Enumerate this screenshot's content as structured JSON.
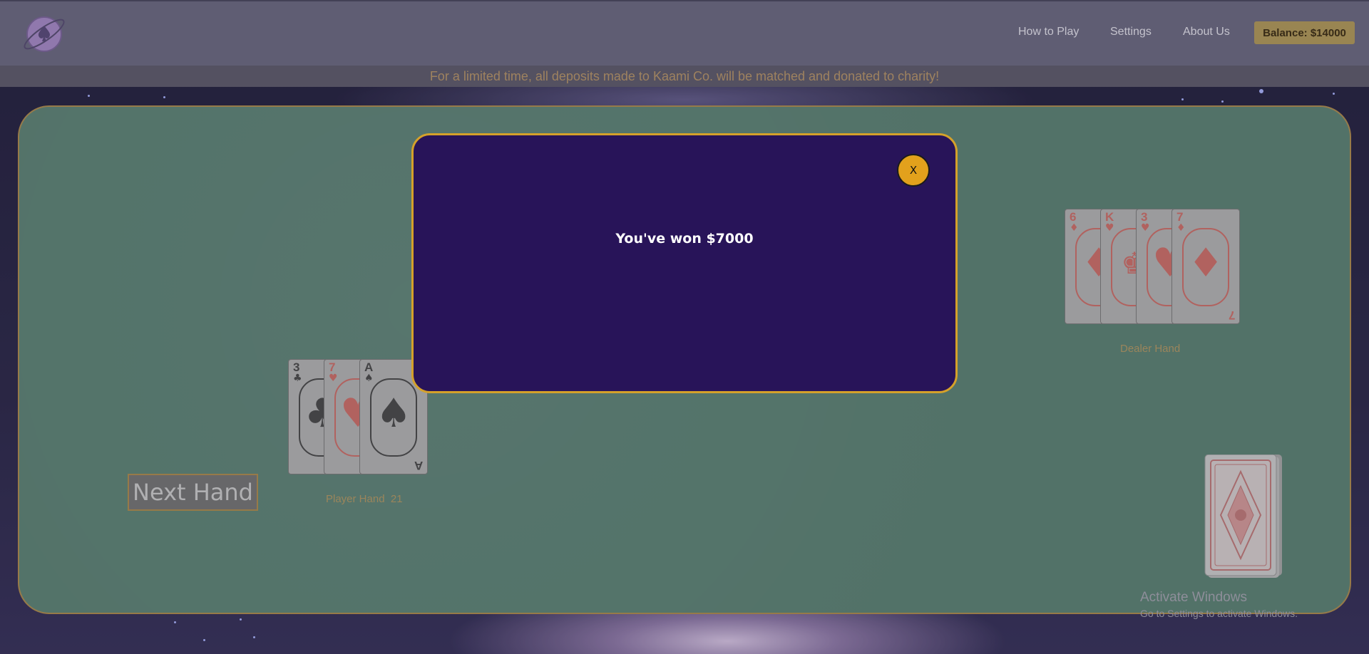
{
  "header": {
    "logo_icon": "planet-spade-logo-icon",
    "nav": [
      {
        "label": "How to Play"
      },
      {
        "label": "Settings"
      },
      {
        "label": "About Us"
      }
    ],
    "balance": "Balance: $14000"
  },
  "promo": "For a limited time, all deposits made to Kaami Co. will be matched and donated to charity!",
  "table": {
    "player": {
      "label": "Player Hand  21",
      "cards": [
        {
          "rank": "3",
          "suit": "♣",
          "color": "black"
        },
        {
          "rank": "7",
          "suit": "♥",
          "color": "red"
        },
        {
          "rank": "A",
          "suit": "♠",
          "color": "black"
        }
      ]
    },
    "dealer": {
      "label": "Dealer Hand",
      "cards": [
        {
          "rank": "6",
          "suit": "♦",
          "color": "red"
        },
        {
          "rank": "K",
          "suit": "♥",
          "color": "red"
        },
        {
          "rank": "3",
          "suit": "♥",
          "color": "red"
        },
        {
          "rank": "7",
          "suit": "♦",
          "color": "red"
        }
      ]
    },
    "next_hand": "Next Hand",
    "deck_icon": "card-deck-icon"
  },
  "modal": {
    "close_label": "X",
    "message": "You've won $7000"
  },
  "windows_notice": {
    "title": "Activate Windows",
    "subtitle": "Go to Settings to activate Windows."
  },
  "colors": {
    "modal_bg": "#281459",
    "modal_border": "#d5a12a",
    "table_felt": "#5e8678",
    "gold_accent": "#b08d4e"
  }
}
